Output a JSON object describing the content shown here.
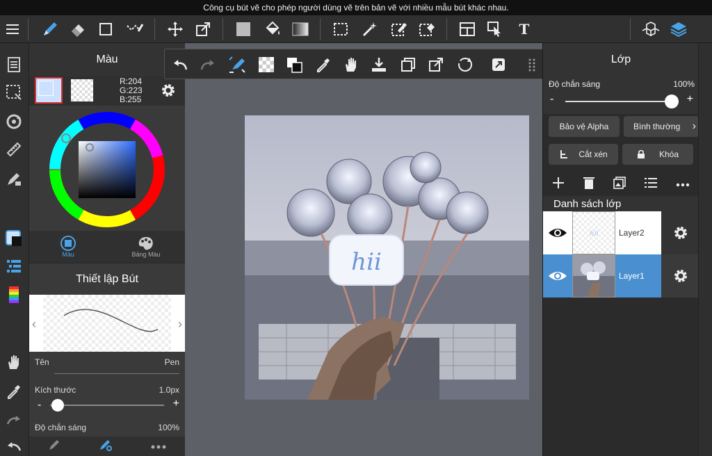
{
  "tooltip": "Công cụ bút vẽ cho phép người dùng vẽ trên bản vẽ với nhiều mẫu bút khác nhau.",
  "colors": {
    "accent": "#4a90d0",
    "current_color": "#ccdfff",
    "panel_bg": "#3a3a3a"
  },
  "color_panel": {
    "title": "Màu",
    "rgb": {
      "r": "R:204",
      "g": "G:223",
      "b": "B:255"
    },
    "tab_color": "Màu",
    "tab_palette": "Bảng Màu"
  },
  "brush_panel": {
    "title": "Thiết lập Bút",
    "name_label": "Tên",
    "name_value": "Pen",
    "size_label": "Kích thước",
    "size_value": "1.0px",
    "opacity_label": "Độ chắn sáng",
    "opacity_value": "100%"
  },
  "layer_panel": {
    "title": "Lớp",
    "opacity_label": "Độ chắn sáng",
    "opacity_value": "100%",
    "minus": "-",
    "plus": "+",
    "alpha_protect": "Bảo vệ Alpha",
    "blend_mode": "Bình thường",
    "clip": "Cắt xén",
    "lock": "Khóa",
    "list_title": "Danh sách lớp",
    "layers": [
      {
        "name": "Layer2"
      },
      {
        "name": "Layer1"
      }
    ]
  },
  "brush_minus": "-",
  "brush_plus": "+",
  "text_tool_glyph": "T"
}
